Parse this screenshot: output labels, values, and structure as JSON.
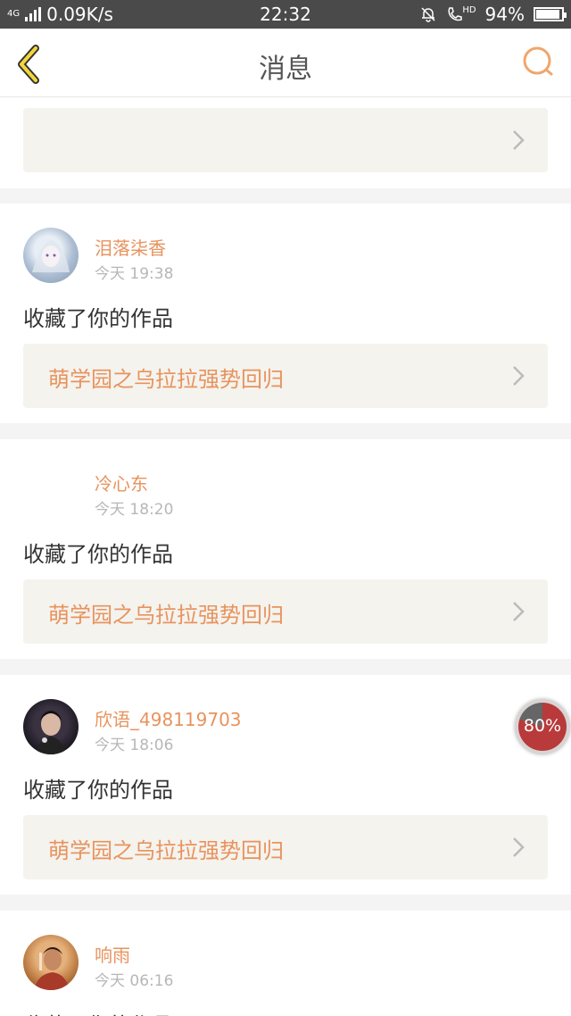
{
  "status_bar": {
    "network": "4G",
    "speed": "0.09K/s",
    "time": "22:32",
    "call_label": "HD",
    "battery": "94%",
    "battery_level": 0.94
  },
  "header": {
    "title": "消息",
    "back_icon": "chevron-left-icon",
    "search_icon": "search-icon",
    "accent_color": "#e5b000"
  },
  "colors": {
    "name": "#e8935e",
    "work_title": "#e8935e",
    "work_bg": "#f4f3ee"
  },
  "messages": [
    {
      "name": "",
      "time": "",
      "action": "",
      "work": ""
    },
    {
      "name": "泪落柒香",
      "time": "今天 19:38",
      "action": "收藏了你的作品",
      "work": "萌学园之乌拉拉强势回归"
    },
    {
      "name": "冷心东",
      "time": "今天 18:20",
      "action": "收藏了你的作品",
      "work": "萌学园之乌拉拉强势回归"
    },
    {
      "name": "欣语_498119703",
      "time": "今天 18:06",
      "action": "收藏了你的作品",
      "work": "萌学园之乌拉拉强势回归"
    },
    {
      "name": "响雨",
      "time": "今天 06:16",
      "action": "收藏了你的作品",
      "work": ""
    }
  ],
  "overlay": {
    "progress": "80%",
    "progress_value": 0.8
  }
}
